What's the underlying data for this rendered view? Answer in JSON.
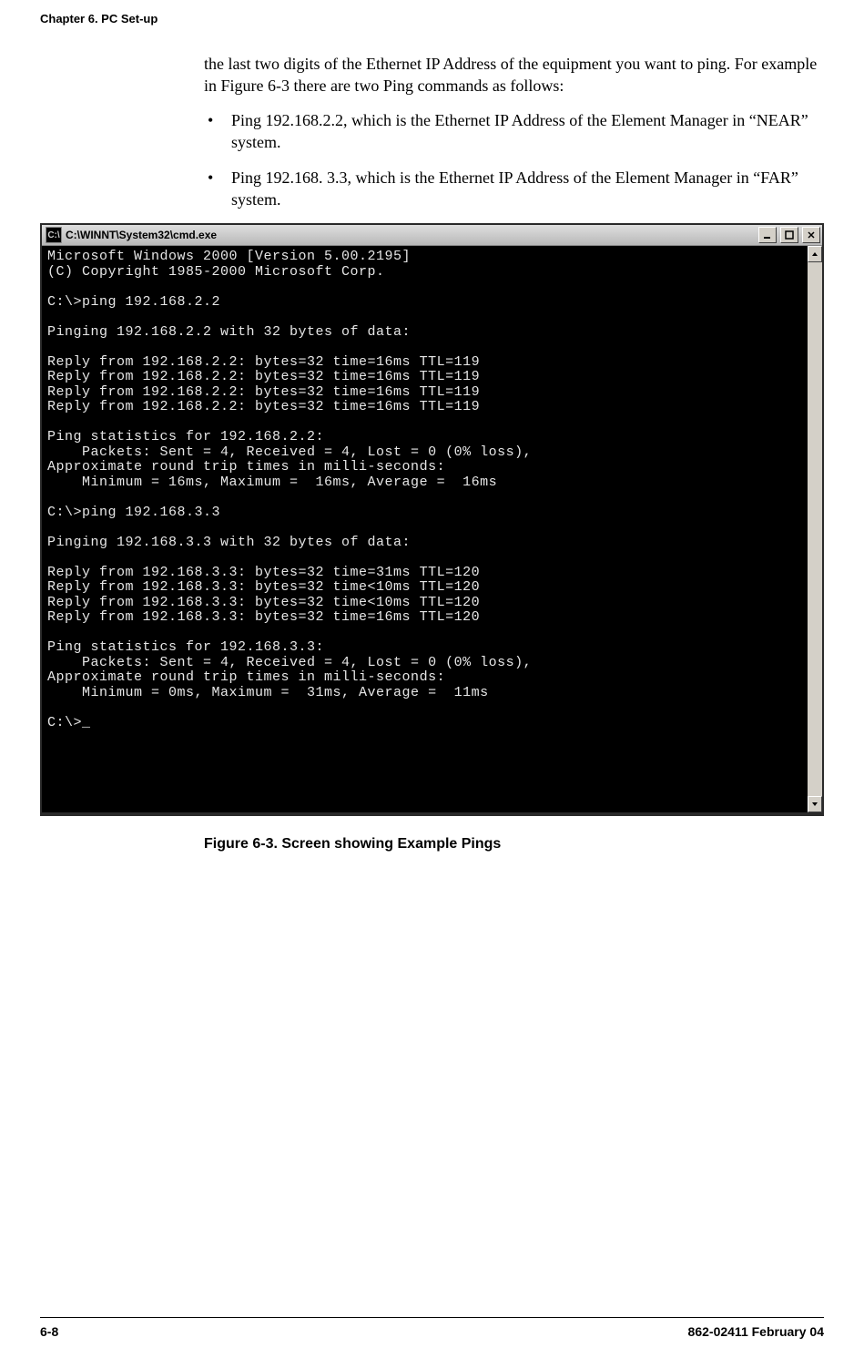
{
  "header": {
    "chapter_title": "Chapter 6. PC Set-up"
  },
  "body": {
    "intro": "the last two digits of the Ethernet IP Address of the equipment you want to ping. For example in Figure 6-3 there are two Ping commands as follows:",
    "bullets": [
      "Ping 192.168.2.2, which is the Ethernet IP Address of the Element Manager in “NEAR” system.",
      "Ping 192.168. 3.3, which is the Ethernet IP Address of the Element Manager in “FAR” system."
    ]
  },
  "window": {
    "title": "C:\\WINNT\\System32\\cmd.exe",
    "sys_icon_label": "C:\\",
    "terminal_text": "Microsoft Windows 2000 [Version 5.00.2195]\n(C) Copyright 1985-2000 Microsoft Corp.\n\nC:\\>ping 192.168.2.2\n\nPinging 192.168.2.2 with 32 bytes of data:\n\nReply from 192.168.2.2: bytes=32 time=16ms TTL=119\nReply from 192.168.2.2: bytes=32 time=16ms TTL=119\nReply from 192.168.2.2: bytes=32 time=16ms TTL=119\nReply from 192.168.2.2: bytes=32 time=16ms TTL=119\n\nPing statistics for 192.168.2.2:\n    Packets: Sent = 4, Received = 4, Lost = 0 (0% loss),\nApproximate round trip times in milli-seconds:\n    Minimum = 16ms, Maximum =  16ms, Average =  16ms\n\nC:\\>ping 192.168.3.3\n\nPinging 192.168.3.3 with 32 bytes of data:\n\nReply from 192.168.3.3: bytes=32 time=31ms TTL=120\nReply from 192.168.3.3: bytes=32 time<10ms TTL=120\nReply from 192.168.3.3: bytes=32 time<10ms TTL=120\nReply from 192.168.3.3: bytes=32 time=16ms TTL=120\n\nPing statistics for 192.168.3.3:\n    Packets: Sent = 4, Received = 4, Lost = 0 (0% loss),\nApproximate round trip times in milli-seconds:\n    Minimum = 0ms, Maximum =  31ms, Average =  11ms\n\nC:\\>_"
  },
  "figure": {
    "caption": "Figure 6-3.  Screen showing Example Pings"
  },
  "footer": {
    "page_no": "6-8",
    "doc_id": "862-02411 February 04"
  }
}
